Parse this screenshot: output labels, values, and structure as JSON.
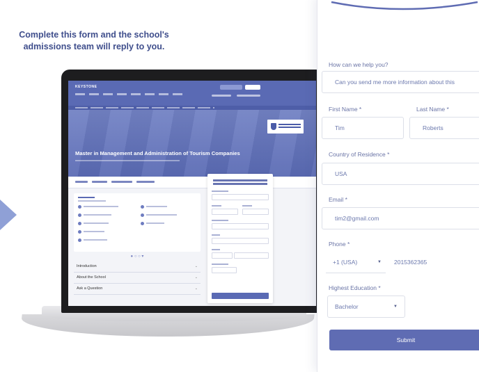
{
  "laptop": {
    "site_logo": "KEYSTONE",
    "program_title": "Master in Management and Administration of Tourism Companies",
    "accordion": [
      "Introduction",
      "About the School",
      "Ask a Question"
    ]
  },
  "form": {
    "title": "Complete this form and the school's admissions team will reply to you.",
    "help_label": "How can we help you?",
    "help_value": "Can you send me more information about this",
    "first_name_label": "First Name *",
    "first_name_value": "Tim",
    "last_name_label": "Last Name *",
    "last_name_value": "Roberts",
    "country_label": "Country of Residence *",
    "country_value": "USA",
    "email_label": "Email *",
    "email_value": "tim2@gmail.com",
    "phone_label": "Phone *",
    "phone_code": "+1 (USA)",
    "phone_value": "2015362365",
    "education_label": "Highest Education *",
    "education_value": "Bachelor",
    "submit_label": "Submit"
  },
  "colors": {
    "accent": "#5f6cb3",
    "title": "#3f4e8c",
    "arrow": "#8fa0d6"
  }
}
